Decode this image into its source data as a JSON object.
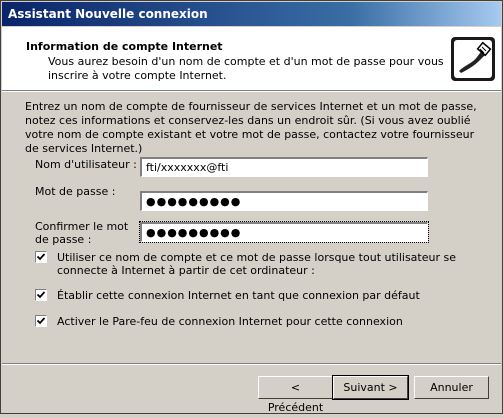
{
  "window": {
    "title": "Assistant Nouvelle connexion"
  },
  "header": {
    "title": "Information de compte Internet",
    "subtitle": "Vous aurez besoin d'un nom de compte et d'un mot de passe pour vous inscrire à votre compte Internet.",
    "icon": "internet-account-icon"
  },
  "intro": "Entrez un nom de compte de fournisseur de services Internet et un mot de passe, notez ces informations et conservez-les dans un endroit sûr. (Si vous avez oublié votre nom de compte existant et votre mot de passe, contactez votre fournisseur de services Internet.)",
  "fields": {
    "username": {
      "label": "Nom d'utilisateur :",
      "value": "fti/xxxxxxx@fti"
    },
    "password": {
      "label": "Mot de passe :",
      "value": "●●●●●●●●●"
    },
    "confirm": {
      "label": "Confirmer le mot de passe :",
      "value": "●●●●●●●●●"
    }
  },
  "checkboxes": [
    {
      "label": "Utiliser ce nom de compte et ce mot de passe lorsque tout utilisateur se connecte à Internet à partir de cet ordinateur :",
      "checked": true
    },
    {
      "label": "Établir cette connexion Internet en tant que connexion par défaut",
      "checked": true
    },
    {
      "label": "Activer le Pare-feu de connexion Internet pour cette connexion",
      "checked": true
    }
  ],
  "buttons": {
    "back": "< Précédent",
    "next": "Suivant >",
    "cancel": "Annuler"
  }
}
